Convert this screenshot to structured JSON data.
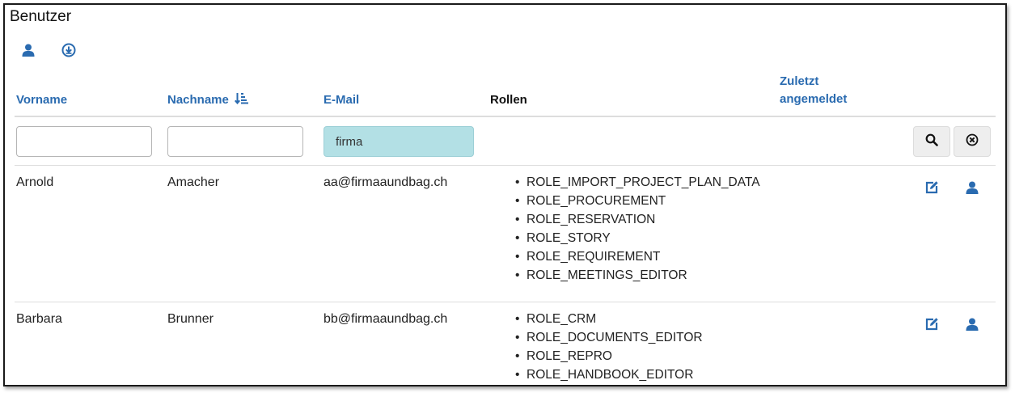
{
  "page": {
    "title": "Benutzer"
  },
  "toolbar": {
    "add_user_icon": "user-icon",
    "export_icon": "download-circle-icon"
  },
  "table": {
    "columns": {
      "first_name": "Vorname",
      "last_name": "Nachname",
      "email": "E-Mail",
      "roles": "Rollen",
      "last_login_line1": "Zuletzt",
      "last_login_line2": "angemeldet"
    },
    "sort": {
      "column": "Nachname",
      "direction": "ascending"
    },
    "filters": {
      "first_name": "",
      "last_name": "",
      "email": "firma"
    },
    "rows": [
      {
        "first_name": "Arnold",
        "last_name": "Amacher",
        "email": "aa@firmaaundbag.ch",
        "last_login": "",
        "roles": [
          "ROLE_IMPORT_PROJECT_PLAN_DATA",
          "ROLE_PROCUREMENT",
          "ROLE_RESERVATION",
          "ROLE_STORY",
          "ROLE_REQUIREMENT",
          "ROLE_MEETINGS_EDITOR"
        ]
      },
      {
        "first_name": "Barbara",
        "last_name": "Brunner",
        "email": "bb@firmaaundbag.ch",
        "last_login": "",
        "roles": [
          "ROLE_CRM",
          "ROLE_DOCUMENTS_EDITOR",
          "ROLE_REPRO",
          "ROLE_HANDBOOK_EDITOR"
        ]
      }
    ]
  },
  "colors": {
    "link": "#2a6bb0",
    "active_filter": "#b3e0e5",
    "button_bg": "#eeeeee"
  }
}
